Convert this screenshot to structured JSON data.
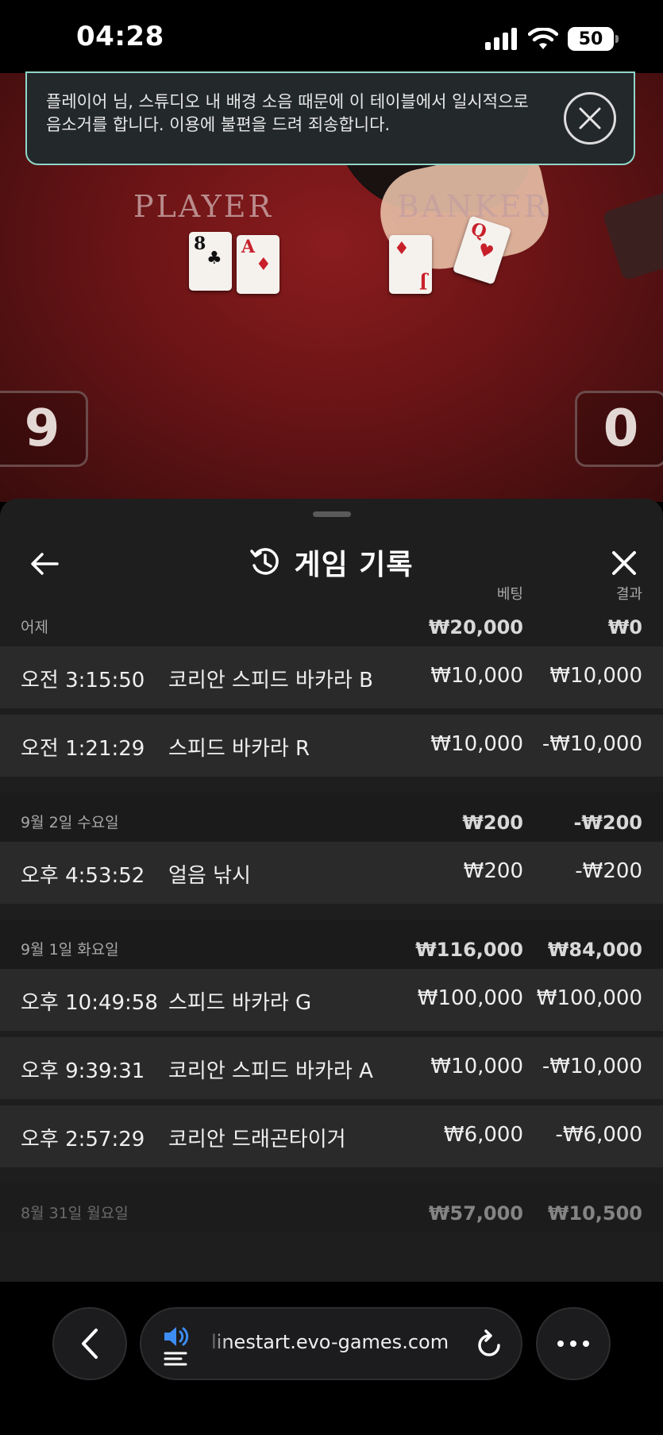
{
  "status_bar": {
    "time": "04:28",
    "battery": "50"
  },
  "video": {
    "player_label": "PLAYER",
    "banker_label": "BANKER",
    "player_score": "9",
    "banker_score": "0",
    "cards": {
      "player_1": "8",
      "player_1_suit": "♣",
      "player_2": "A",
      "player_2_suit": "♦",
      "banker_1": "J",
      "banker_1_suit": "♦",
      "banker_2": "Q",
      "banker_2_suit": "♥"
    }
  },
  "notice": {
    "text": "플레이어 님, 스튜디오 내 배경 소음 때문에 이 테이블에서 일시적으로 음소거를 합니다. 이용에 불편을 드려 죄송합니다."
  },
  "sheet": {
    "title": "게임 기록",
    "col_bet": "베팅",
    "col_result": "결과",
    "groups": [
      {
        "date": "어제",
        "bet": "₩20,000",
        "result": "₩0",
        "rows": [
          {
            "time": "오전 3:15:50",
            "game": "코리안 스피드 바카라 B",
            "bet": "₩10,000",
            "result": "₩10,000"
          },
          {
            "time": "오전 1:21:29",
            "game": "스피드 바카라 R",
            "bet": "₩10,000",
            "result": "-₩10,000"
          }
        ]
      },
      {
        "date": "9월 2일 수요일",
        "bet": "₩200",
        "result": "-₩200",
        "rows": [
          {
            "time": "오후 4:53:52",
            "game": "얼음 낚시",
            "bet": "₩200",
            "result": "-₩200"
          }
        ]
      },
      {
        "date": "9월 1일 화요일",
        "bet": "₩116,000",
        "result": "₩84,000",
        "rows": [
          {
            "time": "오후 10:49:58",
            "game": "스피드 바카라 G",
            "bet": "₩100,000",
            "result": "₩100,000"
          },
          {
            "time": "오후 9:39:31",
            "game": "코리안 스피드 바카라 A",
            "bet": "₩10,000",
            "result": "-₩10,000"
          },
          {
            "time": "오후 2:57:29",
            "game": "코리안 드래곤타이거",
            "bet": "₩6,000",
            "result": "-₩6,000"
          }
        ]
      },
      {
        "date": "8월 31일 월요일",
        "bet": "₩57,000",
        "result": "₩10,500",
        "rows": []
      }
    ]
  },
  "browser": {
    "url": "linestart.evo-games.com"
  }
}
